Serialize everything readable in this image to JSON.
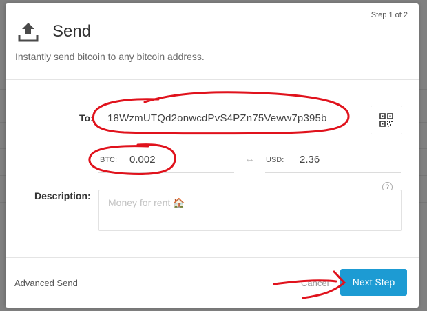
{
  "modal": {
    "step_indicator": "Step 1 of 2",
    "title": "Send",
    "title_icon": "upload-arrow-icon",
    "subtitle": "Instantly send bitcoin to any bitcoin address."
  },
  "form": {
    "to_label": "To:",
    "to_value": "18WzmUTQd2onwcdPvS4PZn75Veww7p395b",
    "qr_icon": "qr-code-icon",
    "btc_currency": "BTC:",
    "btc_value": "0.002",
    "swap_icon": "swap-arrows-icon",
    "usd_currency": "USD:",
    "usd_value": "2.36",
    "description_label": "Description:",
    "description_placeholder": "Money for rent 🏠",
    "help_icon": "?"
  },
  "footer": {
    "advanced_send": "Advanced Send",
    "cancel": "Cancel",
    "next_step": "Next Step"
  },
  "colors": {
    "primary_button": "#1d9bd3",
    "annotation_red": "#e0121c",
    "overlay": "#808080"
  }
}
